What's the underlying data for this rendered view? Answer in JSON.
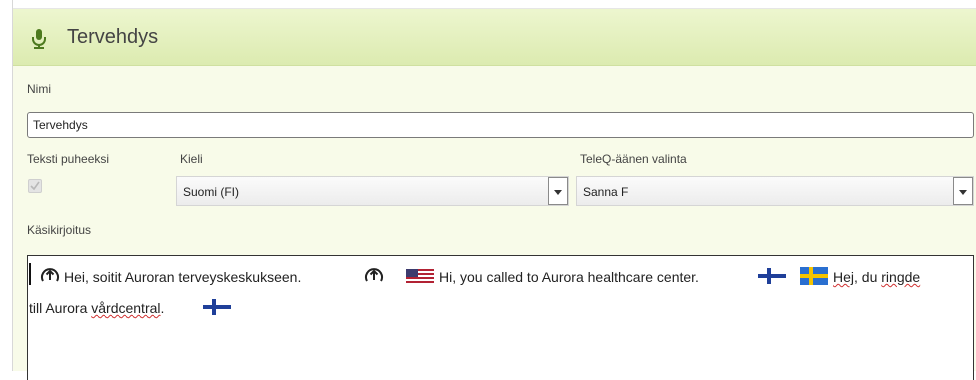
{
  "header": {
    "title": "Tervehdys",
    "icon": "microphone-icon"
  },
  "form": {
    "name_label": "Nimi",
    "name_value": "Tervehdys",
    "tts_label": "Teksti puheeksi",
    "tts_checked": true,
    "language_label": "Kieli",
    "language_value": "Suomi (FI)",
    "voice_label": "TeleQ-äänen valinta",
    "voice_value": "Sanna  F",
    "script_label": "Käsikirjoitus"
  },
  "script": {
    "segment_fi_1": "Hei, soitit Auroran terveyskeskukseen.",
    "segment_en": "Hi, you called to Aurora healthcare center.",
    "segment_sv_a": "Hej",
    "segment_sv_b": ", du ",
    "segment_sv_c": "ringde",
    "segment_sv_d": "till Aurora ",
    "segment_sv_e": "vårdcentral",
    "segment_sv_f": "."
  },
  "colors": {
    "header_bg": "#dcebb0",
    "panel_bg": "#f8fbe9",
    "accent": "#4d7a1e"
  }
}
